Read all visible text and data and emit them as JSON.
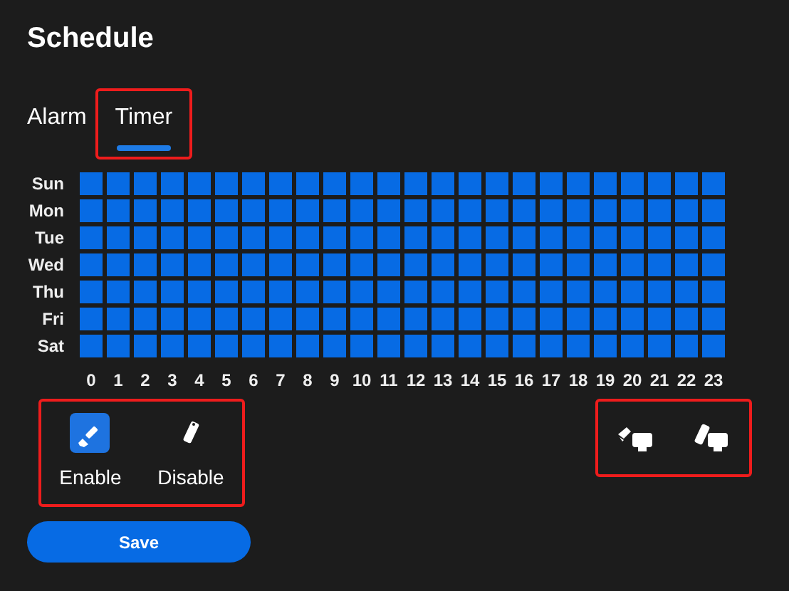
{
  "title": "Schedule",
  "tabs": [
    {
      "label": "Alarm",
      "selected": false
    },
    {
      "label": "Timer",
      "selected": true
    }
  ],
  "schedule": {
    "hours": [
      "0",
      "1",
      "2",
      "3",
      "4",
      "5",
      "6",
      "7",
      "8",
      "9",
      "10",
      "11",
      "12",
      "13",
      "14",
      "15",
      "16",
      "17",
      "18",
      "19",
      "20",
      "21",
      "22",
      "23"
    ],
    "rows": [
      {
        "day": "Sun",
        "slots": [
          true,
          true,
          true,
          true,
          true,
          true,
          true,
          true,
          true,
          true,
          true,
          true,
          true,
          true,
          true,
          true,
          true,
          true,
          true,
          true,
          true,
          true,
          true,
          true
        ]
      },
      {
        "day": "Mon",
        "slots": [
          true,
          true,
          true,
          true,
          true,
          true,
          true,
          true,
          true,
          true,
          true,
          true,
          true,
          true,
          true,
          true,
          true,
          true,
          true,
          true,
          true,
          true,
          true,
          true
        ]
      },
      {
        "day": "Tue",
        "slots": [
          true,
          true,
          true,
          true,
          true,
          true,
          true,
          true,
          true,
          true,
          true,
          true,
          true,
          true,
          true,
          true,
          true,
          true,
          true,
          true,
          true,
          true,
          true,
          true
        ]
      },
      {
        "day": "Wed",
        "slots": [
          true,
          true,
          true,
          true,
          true,
          true,
          true,
          true,
          true,
          true,
          true,
          true,
          true,
          true,
          true,
          true,
          true,
          true,
          true,
          true,
          true,
          true,
          true,
          true
        ]
      },
      {
        "day": "Thu",
        "slots": [
          true,
          true,
          true,
          true,
          true,
          true,
          true,
          true,
          true,
          true,
          true,
          true,
          true,
          true,
          true,
          true,
          true,
          true,
          true,
          true,
          true,
          true,
          true,
          true
        ]
      },
      {
        "day": "Fri",
        "slots": [
          true,
          true,
          true,
          true,
          true,
          true,
          true,
          true,
          true,
          true,
          true,
          true,
          true,
          true,
          true,
          true,
          true,
          true,
          true,
          true,
          true,
          true,
          true,
          true
        ]
      },
      {
        "day": "Sat",
        "slots": [
          true,
          true,
          true,
          true,
          true,
          true,
          true,
          true,
          true,
          true,
          true,
          true,
          true,
          true,
          true,
          true,
          true,
          true,
          true,
          true,
          true,
          true,
          true,
          true
        ]
      }
    ]
  },
  "modes": [
    {
      "kind": "enable",
      "label": "Enable",
      "selected": true
    },
    {
      "kind": "disable",
      "label": "Disable",
      "selected": false
    }
  ],
  "save_button": "Save"
}
